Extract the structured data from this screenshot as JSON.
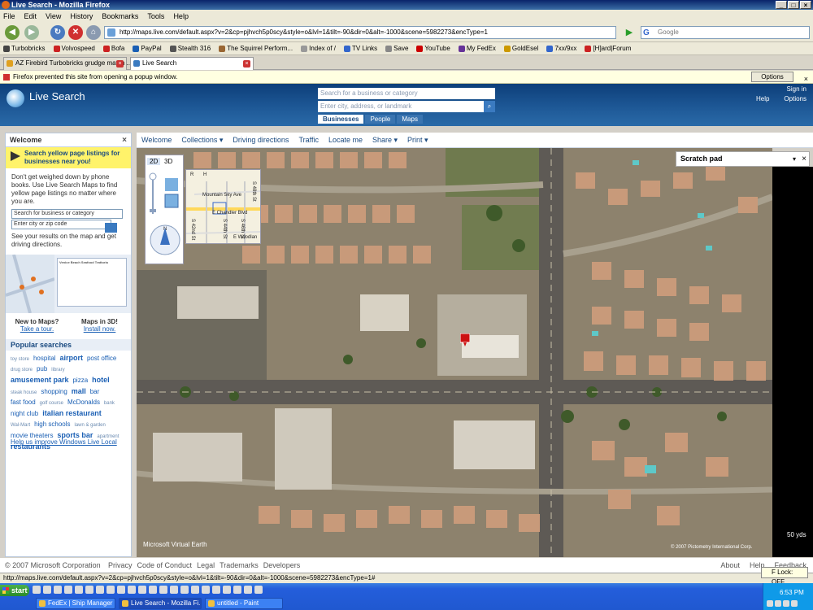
{
  "window": {
    "title": "Live Search - Mozilla Firefox",
    "controls": [
      "_",
      "□",
      "×"
    ]
  },
  "menu": [
    "File",
    "Edit",
    "View",
    "History",
    "Bookmarks",
    "Tools",
    "Help"
  ],
  "nav": {
    "url": "http://maps.live.com/default.aspx?v=2&cp=pjhvch5p0scy&style=o&lvl=1&tilt=-90&dir=0&alt=-1000&scene=5982273&encType=1",
    "search_placeholder": "Google",
    "search_engine_glyph": "G"
  },
  "bookmarks": [
    {
      "label": "Turbobricks",
      "color": "#444444"
    },
    {
      "label": "Volvospeed",
      "color": "#cc2222"
    },
    {
      "label": "Bofa",
      "color": "#cc2222"
    },
    {
      "label": "PayPal",
      "color": "#1a5fb4"
    },
    {
      "label": "Stealth 316",
      "color": "#555555"
    },
    {
      "label": "The Squirrel Perform...",
      "color": "#996633"
    },
    {
      "label": "Index of /",
      "color": "#999999"
    },
    {
      "label": "TV Links",
      "color": "#3366cc"
    },
    {
      "label": "Save",
      "color": "#888888"
    },
    {
      "label": "YouTube",
      "color": "#cc0000"
    },
    {
      "label": "My FedEx",
      "color": "#663399"
    },
    {
      "label": "GoldEsel",
      "color": "#cc9900"
    },
    {
      "label": "7xx/9xx",
      "color": "#3366cc"
    },
    {
      "label": "[H]ard|Forum",
      "color": "#cc2222"
    }
  ],
  "tabs": [
    {
      "label": "AZ Firebird Turbobricks grudge match ...",
      "active": false
    },
    {
      "label": "Live Search",
      "active": true
    }
  ],
  "popup_bar": {
    "message": "Firefox prevented this site from opening a popup window.",
    "options_label": "Options",
    "close": "×"
  },
  "header": {
    "brand": "Live Search",
    "business_placeholder": "Search for a business or category",
    "address_placeholder": "Enter city, address, or landmark",
    "scope_tabs": [
      "Businesses",
      "People",
      "Maps"
    ],
    "sign_in": "Sign in",
    "help": "Help",
    "options": "Options"
  },
  "left_panel": {
    "title": "Welcome",
    "close": "×",
    "promo": "Search yellow page listings for businesses near you!",
    "description": "Don't get weighed down by phone books. Use Live Search Maps to find yellow page listings no matter where you are.",
    "business_placeholder": "Search for business or category",
    "location_placeholder": "Enter city or zip code",
    "see_results": "See your results on the map and get driving directions.",
    "thumb_card_title": "Venice Beach Seafood Trattoria",
    "new_to_maps": {
      "title": "New to Maps?",
      "link": "Take a tour."
    },
    "maps_3d": {
      "title": "Maps in 3D!",
      "link": "Install now."
    },
    "popular_title": "Popular searches",
    "popular_tags": [
      {
        "t": "toy store",
        "s": "s"
      },
      {
        "t": "hospital",
        "s": "m"
      },
      {
        "t": "airport",
        "s": "l"
      },
      {
        "t": "post office",
        "s": "m"
      },
      {
        "t": "drug store",
        "s": "s"
      },
      {
        "t": "pub",
        "s": "m"
      },
      {
        "t": "library",
        "s": "s"
      },
      {
        "t": "amusement park",
        "s": "l"
      },
      {
        "t": "pizza",
        "s": "m"
      },
      {
        "t": "hotel",
        "s": "l"
      },
      {
        "t": "steak house",
        "s": "s"
      },
      {
        "t": "shopping",
        "s": "m"
      },
      {
        "t": "mall",
        "s": "l"
      },
      {
        "t": "bar",
        "s": "m"
      },
      {
        "t": "fast food",
        "s": "m"
      },
      {
        "t": "golf course",
        "s": "s"
      },
      {
        "t": "McDonalds",
        "s": "m"
      },
      {
        "t": "bank",
        "s": "s"
      },
      {
        "t": "night club",
        "s": "m"
      },
      {
        "t": "italian restaurant",
        "s": "l"
      },
      {
        "t": "Wal-Mart",
        "s": "s"
      },
      {
        "t": "high schools",
        "s": "m"
      },
      {
        "t": "lawn & garden",
        "s": "s"
      },
      {
        "t": "movie theaters",
        "s": "m"
      },
      {
        "t": "sports bar",
        "s": "l"
      },
      {
        "t": "apartment",
        "s": "s"
      },
      {
        "t": "restaurants",
        "s": "l"
      }
    ],
    "help_link": "Help us improve Windows Live Local"
  },
  "map_toolbar": [
    "Welcome",
    "Collections ▾",
    "Driving directions",
    "Traffic",
    "Locate me",
    "Share ▾",
    "Print ▾"
  ],
  "map": {
    "scratch_pad": "Scratch pad",
    "view_modes": [
      "2D",
      "3D"
    ],
    "minimap_tabs": [
      "R",
      "H"
    ],
    "minimap_labels": [
      "Mountain Sky Ave",
      "E Chandler Blvd",
      "S 42nd St",
      "S 44th St",
      "S 46th St",
      "S 48th St",
      "E Woodlan"
    ],
    "scale": "50 yds",
    "logo": "Microsoft Virtual Earth",
    "imagery_credit": "© 2007 Pictometry International Corp.",
    "pin_color": "#cc1111"
  },
  "footer": {
    "copyright": "© 2007 Microsoft Corporation",
    "links": [
      "Privacy",
      "Code of Conduct",
      "Legal",
      "Trademarks",
      "Developers"
    ],
    "right_links": [
      "About",
      "Help",
      "Feedback"
    ]
  },
  "status": {
    "url": "http://maps.live.com/default.aspx?v=2&cp=pjhvch5p0scy&style=o&lvl=1&tilt=-90&dir=0&alt=-1000&scene=5982273&encType=1#",
    "flock": "F Lock: OFF"
  },
  "taskbar": {
    "start": "start",
    "tasks": [
      {
        "label": "FedEx | Ship Manager | S...",
        "active": false
      },
      {
        "label": "Live Search - Mozilla Fi...",
        "active": true
      },
      {
        "label": "untitled - Paint",
        "active": false
      }
    ],
    "clock": "6:53 PM"
  }
}
